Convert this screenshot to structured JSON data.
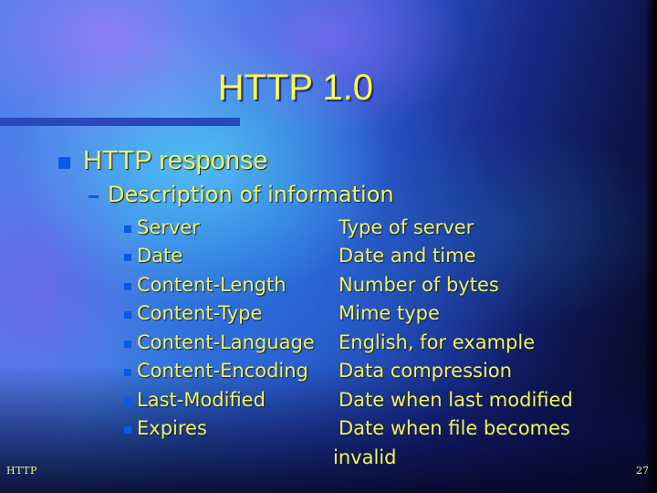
{
  "slide": {
    "title": "HTTP 1.0",
    "level1": {
      "text": "HTTP response",
      "bullet_icon": "square-bullet-icon"
    },
    "level2": {
      "text": "Description of information",
      "bullet_icon": "dash-bullet-icon"
    },
    "items": [
      {
        "name": "Server",
        "description": "Type of server"
      },
      {
        "name": "Date",
        "description": "Date and time"
      },
      {
        "name": "Content-Length",
        "description": "Number of bytes"
      },
      {
        "name": "Content-Type",
        "description": "Mime type"
      },
      {
        "name": "Content-Language",
        "description": "English, for example"
      },
      {
        "name": "Content-Encoding",
        "description": "Data compression"
      },
      {
        "name": "Last-Modified",
        "description": "Date when last modified"
      },
      {
        "name": "Expires",
        "description": "Date when file becomes",
        "description_continued": "invalid"
      }
    ],
    "footer": {
      "left": "HTTP",
      "page_number": "27"
    }
  },
  "colors": {
    "text": "#f2f25a",
    "title": "#ffff44",
    "bullet": "#0a5ae8",
    "title_rule": "#2a49b8"
  }
}
